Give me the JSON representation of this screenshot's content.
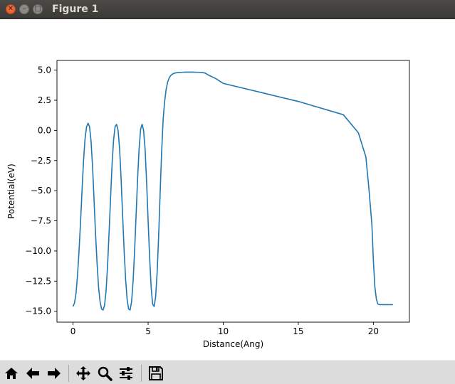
{
  "window": {
    "title": "Figure 1"
  },
  "toolbar": {
    "buttons": [
      {
        "name": "home",
        "icon": "home-icon"
      },
      {
        "name": "back",
        "icon": "arrow-left-icon"
      },
      {
        "name": "forward",
        "icon": "arrow-right-icon"
      },
      {
        "name": "pan",
        "icon": "move-icon"
      },
      {
        "name": "zoom",
        "icon": "magnifier-icon"
      },
      {
        "name": "configure",
        "icon": "sliders-icon"
      },
      {
        "name": "save",
        "icon": "floppy-disk-icon"
      }
    ]
  },
  "chart_data": {
    "type": "line",
    "title": "",
    "xlabel": "Distance(Ang)",
    "ylabel": "Potential(eV)",
    "xlim": [
      -1.07,
      22.4
    ],
    "ylim": [
      -15.9,
      5.8
    ],
    "xticks": [
      0,
      5,
      10,
      15,
      20
    ],
    "yticks": [
      5.0,
      2.5,
      0.0,
      -2.5,
      -5.0,
      -7.5,
      -10.0,
      -12.5,
      -15.0
    ],
    "xtick_labels": [
      "0",
      "5",
      "10",
      "15",
      "20"
    ],
    "ytick_labels": [
      "5.0",
      "2.5",
      "0.0",
      "−2.5",
      "−5.0",
      "−7.5",
      "−10.0",
      "−12.5",
      "−15.0"
    ],
    "grid": false,
    "color": "#1f77b4",
    "series": [
      {
        "x": [
          0.0,
          0.1,
          0.2,
          0.3,
          0.4,
          0.5,
          0.6,
          0.7,
          0.8,
          0.9,
          1.0,
          1.1,
          1.2,
          1.3,
          1.4,
          1.5,
          1.6,
          1.7,
          1.8,
          1.9,
          2.0,
          2.1,
          2.2,
          2.3,
          2.4,
          2.5,
          2.6,
          2.7,
          2.8,
          2.9,
          3.0,
          3.1,
          3.2,
          3.3,
          3.4,
          3.5,
          3.6,
          3.7,
          3.8,
          3.9,
          4.0,
          4.1,
          4.2,
          4.3,
          4.4,
          4.5,
          4.6,
          4.7,
          4.8,
          4.9,
          5.0,
          5.1,
          5.2,
          5.3,
          5.4,
          5.5,
          5.6,
          5.7,
          5.8,
          5.9,
          6.0,
          6.1,
          6.2,
          6.3,
          6.4,
          6.5,
          6.6,
          6.7,
          6.8,
          6.9,
          7.0,
          7.1,
          7.2,
          7.3,
          7.4,
          7.5,
          7.6,
          7.7,
          7.8,
          7.9,
          8.0,
          8.2,
          8.4,
          8.6,
          8.8,
          9.0,
          9.5,
          10.0,
          12.0,
          15.0,
          18.0,
          19.0,
          19.5,
          19.7,
          19.9,
          20.0,
          20.1,
          20.2,
          20.3,
          20.4,
          20.5,
          20.6,
          20.7,
          20.8,
          20.9,
          21.0,
          21.1,
          21.2,
          21.3
        ],
        "y": [
          -14.6,
          -14.3,
          -13.5,
          -12.0,
          -10.0,
          -7.6,
          -5.0,
          -2.5,
          -0.7,
          0.3,
          0.6,
          0.3,
          -0.9,
          -3.0,
          -5.8,
          -8.6,
          -11.0,
          -13.0,
          -14.2,
          -14.8,
          -14.9,
          -14.5,
          -13.3,
          -11.2,
          -8.5,
          -5.6,
          -2.8,
          -0.8,
          0.3,
          0.5,
          0.0,
          -1.5,
          -4.0,
          -7.0,
          -9.9,
          -12.3,
          -14.0,
          -14.8,
          -14.9,
          -14.2,
          -12.5,
          -10.0,
          -7.0,
          -4.0,
          -1.5,
          0.1,
          0.5,
          0.0,
          -1.6,
          -4.3,
          -7.5,
          -10.5,
          -13.0,
          -14.4,
          -14.6,
          -13.8,
          -11.8,
          -8.8,
          -5.2,
          -1.8,
          0.9,
          2.4,
          3.4,
          4.0,
          4.35,
          4.55,
          4.65,
          4.72,
          4.76,
          4.78,
          4.8,
          4.81,
          4.82,
          4.82,
          4.83,
          4.83,
          4.83,
          4.83,
          4.83,
          4.83,
          4.83,
          4.82,
          4.82,
          4.8,
          4.75,
          4.6,
          4.3,
          3.9,
          3.3,
          2.4,
          1.3,
          -0.2,
          -2.2,
          -4.8,
          -7.8,
          -10.8,
          -13.0,
          -14.0,
          -14.4,
          -14.45,
          -14.45,
          -14.45,
          -14.45,
          -14.45,
          -14.45,
          -14.45,
          -14.45,
          -14.45,
          -14.45
        ]
      }
    ]
  }
}
